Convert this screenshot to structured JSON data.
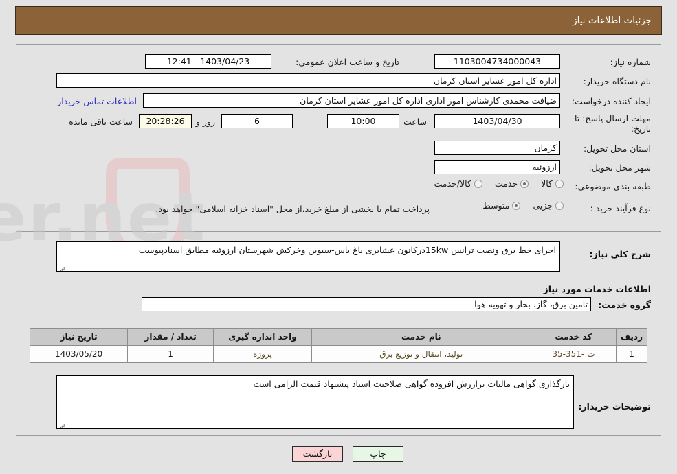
{
  "header": {
    "title": "جزئیات اطلاعات نیاز"
  },
  "top_form": {
    "need_number": {
      "label": "شماره نیاز:",
      "value": "1103004734000043"
    },
    "announce_datetime": {
      "label": "تاریخ و ساعت اعلان عمومی:",
      "value": "1403/04/23 - 12:41"
    },
    "buyer_org": {
      "label": "نام دستگاه خریدار:",
      "value": "اداره کل امور عشایر استان کرمان"
    },
    "province_field_value": "کرمان",
    "creator": {
      "label": "ایجاد کننده درخواست:",
      "value": "ضیافت محمدی کارشناس امور اداری اداره کل امور عشایر استان کرمان"
    },
    "buyer_contact_link": "اطلاعات تماس خریدار",
    "deadline": {
      "label": "مهلت ارسال پاسخ: تا تاریخ:",
      "date": "1403/04/30",
      "time_label": "ساعت",
      "time": "10:00",
      "days": "6",
      "days_suffix": "روز و",
      "countdown": "20:28:26",
      "countdown_suffix": "ساعت باقی مانده"
    },
    "delivery_province": {
      "label": "استان محل تحویل:",
      "value": "کرمان"
    },
    "delivery_city": {
      "label": "شهر محل تحویل:",
      "value": "ارزوئیه"
    },
    "category": {
      "label": "طبقه بندی موضوعی:",
      "options": [
        {
          "label": "کالا",
          "selected": false
        },
        {
          "label": "خدمت",
          "selected": true
        },
        {
          "label": "کالا/خدمت",
          "selected": false
        }
      ]
    },
    "purchase_process": {
      "label": "نوع فرآیند خرید :",
      "options": [
        {
          "label": "جزیی",
          "selected": false
        },
        {
          "label": "متوسط",
          "selected": true
        }
      ],
      "note": "پرداخت تمام یا بخشی از مبلغ خرید،از محل \"اسناد خزانه اسلامی\" خواهد بود."
    }
  },
  "bottom_form": {
    "general_desc": {
      "label": "شرح کلی نیاز:",
      "value": "اجرای خط برق ونصب ترانس 15kwدرکانون عشایری باغ یاس-سیوین وخرکش شهرستان ارزوئیه مطابق اسنادپیوست"
    },
    "section_title": "اطلاعات خدمات مورد نیاز",
    "service_group": {
      "label": "گروه خدمت:",
      "value": "تامین برق، گاز، بخار و تهویه هوا"
    },
    "table": {
      "headers": [
        "ردیف",
        "کد خدمت",
        "نام خدمت",
        "واحد اندازه گیری",
        "تعداد / مقدار",
        "تاریخ نیاز"
      ],
      "rows": [
        {
          "row": "1",
          "service_code": "ت -351-35",
          "service_name": "تولید، انتقال و توزیع برق",
          "unit": "پروژه",
          "quantity": "1",
          "need_date": "1403/05/20"
        }
      ]
    },
    "buyer_notes": {
      "label": "توضیحات خریدار:",
      "value": "بارگذاری گواهی مالیات برارزش افزوده گواهی صلاحیت اسناد پیشنهاد قیمت الزامی است"
    }
  },
  "footer": {
    "back_label": "بازگشت",
    "print_label": "چاپ"
  },
  "colors": {
    "header_bg": "#8c6239",
    "page_bg": "#e3e3e3",
    "link": "#2b2bbd",
    "table_header_bg": "#c9c9c9",
    "back_btn_bg": "#fbd5d5",
    "print_btn_bg": "#e6f7e6"
  },
  "watermark": {
    "text": "AriaTender.net"
  }
}
